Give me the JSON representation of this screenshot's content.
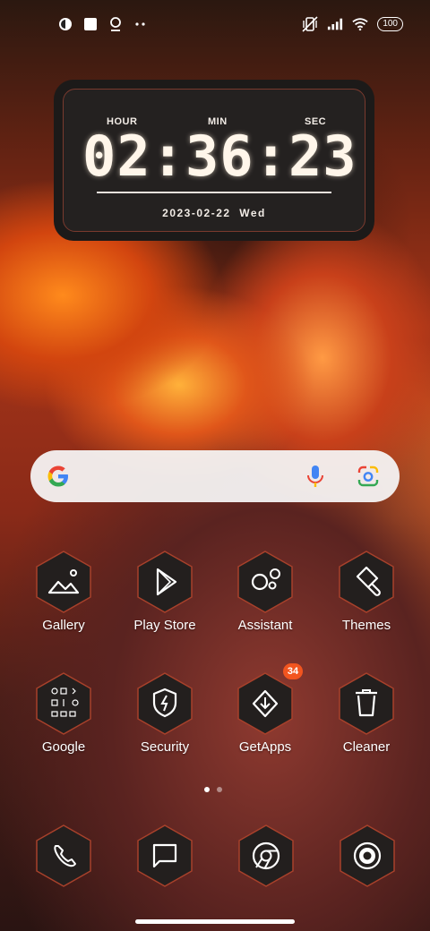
{
  "status_bar": {
    "left_icons": [
      "weather-icon",
      "notification-square-icon",
      "location-pin-icon",
      "more-dots-icon"
    ],
    "right_icons": [
      "vibrate-off-icon",
      "signal-bars-icon",
      "wifi-icon"
    ],
    "battery": "100"
  },
  "clock_widget": {
    "hour_label": "HOUR",
    "min_label": "MIN",
    "sec_label": "SEC",
    "time": "02:36:23",
    "date": "2023-02-22",
    "weekday": "Wed"
  },
  "search_bar": {
    "logo": "google-g-icon",
    "mic_icon": "microphone-icon",
    "lens_icon": "google-lens-icon"
  },
  "apps": [
    {
      "label": "Gallery",
      "icon": "gallery-icon"
    },
    {
      "label": "Play Store",
      "icon": "play-store-icon"
    },
    {
      "label": "Assistant",
      "icon": "assistant-icon"
    },
    {
      "label": "Themes",
      "icon": "themes-brush-icon"
    },
    {
      "label": "Google",
      "icon": "google-folder-icon"
    },
    {
      "label": "Security",
      "icon": "security-shield-icon"
    },
    {
      "label": "GetApps",
      "icon": "getapps-icon",
      "badge": "34"
    },
    {
      "label": "Cleaner",
      "icon": "cleaner-trash-icon"
    }
  ],
  "page_indicator": {
    "pages": 2,
    "active": 1
  },
  "dock": [
    {
      "icon": "phone-icon"
    },
    {
      "icon": "messages-icon"
    },
    {
      "icon": "chrome-icon"
    },
    {
      "icon": "camera-icon"
    }
  ],
  "colors": {
    "hex_fill": "#231f1e",
    "hex_border": "#a8412b",
    "badge": "#f2551f"
  }
}
